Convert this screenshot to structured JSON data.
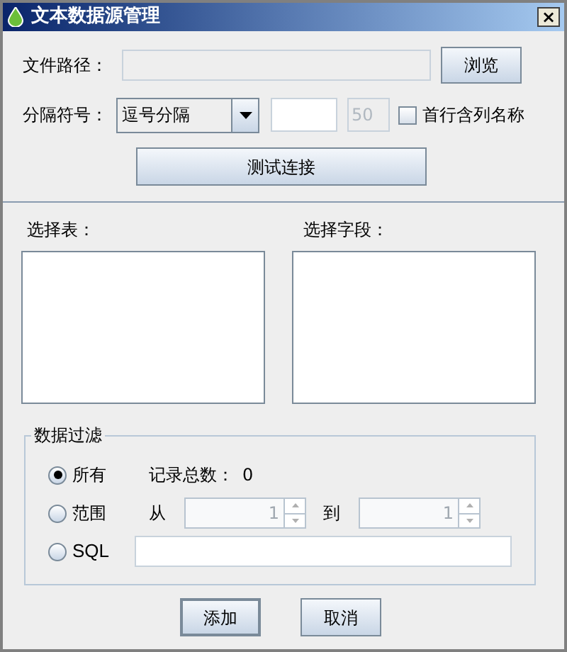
{
  "window": {
    "title": "文本数据源管理",
    "close": "×"
  },
  "file_path": {
    "label": "文件路径：",
    "disabled": true
  },
  "browse_button": "浏览",
  "delimiter": {
    "label": "分隔符号：",
    "value": "逗号分隔",
    "limit_value": "50",
    "limit_disabled": true
  },
  "header_checkbox": {
    "label": "首行含列名称",
    "checked": false
  },
  "test_button": "测试连接",
  "table_list": {
    "label": "选择表："
  },
  "field_list": {
    "label": "选择字段："
  },
  "filter": {
    "title": "数据过滤",
    "options": [
      {
        "kind": "all",
        "label": "所有",
        "selected": true
      },
      {
        "kind": "range",
        "label": "范围",
        "selected": false
      },
      {
        "kind": "sql",
        "label": "SQL",
        "selected": false
      }
    ],
    "record_count_label": "记录总数：",
    "record_count": "0",
    "range_from_label": "从",
    "range_from": "1",
    "range_to_label": "到",
    "range_to": "1",
    "range_disabled": true
  },
  "buttons": [
    {
      "label": "添加",
      "focused": true
    },
    {
      "label": "取消",
      "focused": false
    }
  ]
}
